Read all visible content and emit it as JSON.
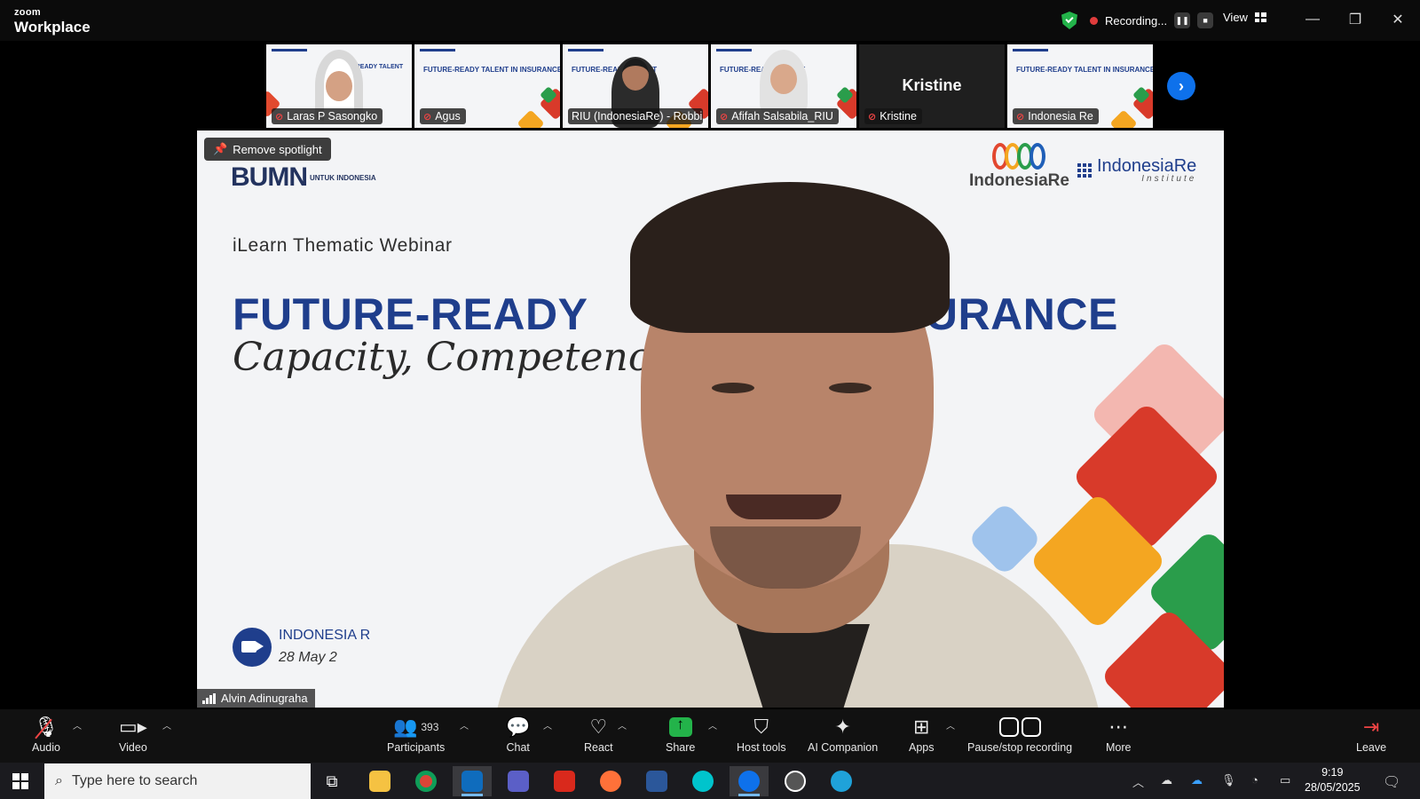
{
  "app": {
    "brand_small": "zoom",
    "brand_title": "Workplace"
  },
  "recording": {
    "label": "Recording..."
  },
  "view": {
    "label": "View"
  },
  "thumbnails": [
    {
      "name": "Laras P Sasongko",
      "slide_text": "FUTURE-READY TALENT",
      "type": "person"
    },
    {
      "name": "Agus",
      "slide_text": "FUTURE-READY TALENT IN INSURANCE",
      "type": "slide"
    },
    {
      "name": "RIU (IndonesiaRe) - Robbi...",
      "slide_text": "FUTURE-READY TALENT",
      "type": "person"
    },
    {
      "name": "Afifah Salsabila_RIU",
      "slide_text": "FUTURE-READY TALENT",
      "type": "person"
    },
    {
      "name": "Kristine",
      "big_name": "Kristine",
      "type": "dark"
    },
    {
      "name": "Indonesia Re",
      "slide_text": "FUTURE-READY TALENT IN INSURANCE",
      "type": "slide"
    }
  ],
  "main_video": {
    "spotlight_label": "Remove spotlight",
    "slide": {
      "logo_bumn": "BUMN",
      "logo_bumn_sub": "UNTUK INDONESIA",
      "logo_ire": "IndonesiaRe",
      "logo_iri": "IndonesiaRe",
      "logo_iri_sub": "Institute",
      "kicker": "iLearn Thematic Webinar",
      "headline_left": "FUTURE-READY",
      "headline_right": "NSURANCE",
      "script_line": "Capacity, Competency, and Cultu",
      "event_name": "INDONESIA R",
      "event_date": "28 May 2"
    },
    "speaker_name": "Alvin Adinugraha"
  },
  "toolbar": {
    "audio": "Audio",
    "video": "Video",
    "participants": "Participants",
    "participants_count": "393",
    "chat": "Chat",
    "react": "React",
    "share": "Share",
    "host_tools": "Host tools",
    "ai_companion": "AI Companion",
    "apps": "Apps",
    "pause_stop": "Pause/stop recording",
    "more": "More",
    "leave": "Leave"
  },
  "taskbar": {
    "search_placeholder": "Type here to search",
    "time": "9:19",
    "date": "28/05/2025"
  },
  "colors": {
    "brand_blue": "#1f3e8c",
    "zoom_blue": "#0e71eb",
    "share_green": "#23b34a",
    "mute_red": "#e44444"
  }
}
